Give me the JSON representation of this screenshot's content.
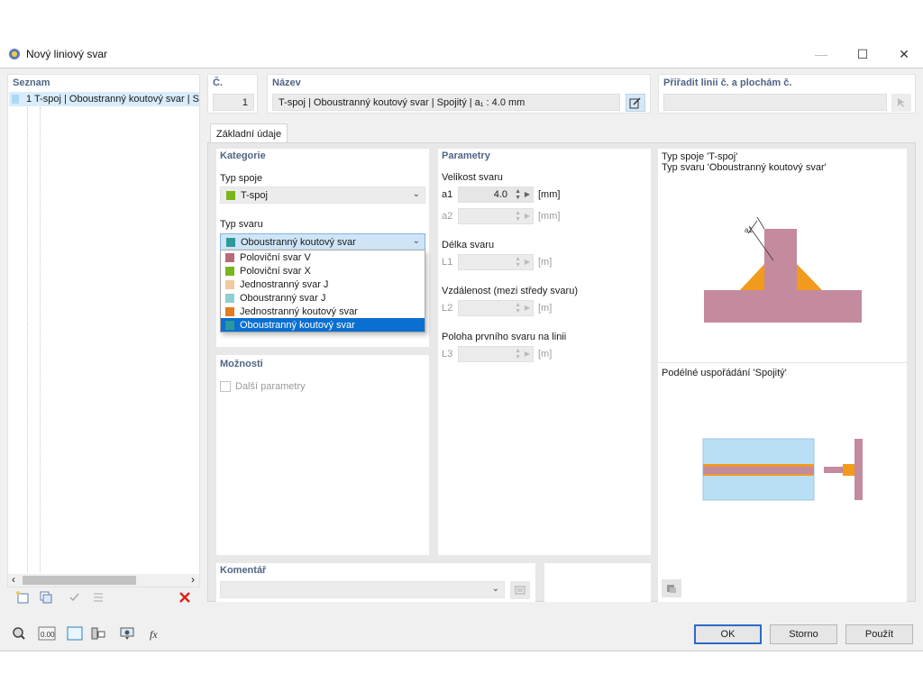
{
  "window": {
    "title": "Nový liniový svar",
    "minimize": "—",
    "maximize": "☐",
    "close": "✕"
  },
  "list": {
    "title": "Seznam",
    "items": [
      {
        "label": "1  T-spoj | Oboustranný koutový svar | S",
        "color": "#a9d9f5"
      }
    ],
    "scroll_left": "‹",
    "scroll_right": "›"
  },
  "header": {
    "no_label": "Č.",
    "no_value": "1",
    "name_label": "Název",
    "name_value": "T-spoj | Oboustranný koutový svar | Spojitý | a₁ : 4.0 mm",
    "assign_label": "Přiřadit linii č. a plochám č.",
    "assign_value": ""
  },
  "tabs": [
    {
      "label": "Základní údaje"
    }
  ],
  "category": {
    "title": "Kategorie",
    "joint_type_label": "Typ spoje",
    "joint_type_value": "T-spoj",
    "joint_type_color": "#7ab51d",
    "weld_type_label": "Typ svaru",
    "weld_type_value": "Oboustranný koutový svar",
    "weld_type_color": "#2a9a9a",
    "options": [
      {
        "label": "Poloviční svar V",
        "color": "#b86a7a"
      },
      {
        "label": "Poloviční svar X",
        "color": "#7ab51d"
      },
      {
        "label": "Jednostranný svar J",
        "color": "#f2c9a0"
      },
      {
        "label": "Oboustranný svar J",
        "color": "#8ecfd0"
      },
      {
        "label": "Jednostranný koutový svar",
        "color": "#e57c1e"
      },
      {
        "label": "Oboustranný koutový svar",
        "color": "#2a9a9a"
      }
    ]
  },
  "options_section": {
    "title": "Možnosti",
    "more_params": "Další parametry"
  },
  "parameters": {
    "title": "Parametry",
    "weld_size_label": "Velikost svaru",
    "a1_label": "a1",
    "a1_value": "4.0",
    "a1_unit": "[mm]",
    "a2_label": "a2",
    "a2_value": "",
    "a2_unit": "[mm]",
    "weld_length_label": "Délka svaru",
    "l1_label": "L1",
    "l1_unit": "[m]",
    "spacing_label": "Vzdálenost (mezi středy svaru)",
    "l2_label": "L2",
    "l2_unit": "[m]",
    "first_pos_label": "Poloha prvního svaru na linii",
    "l3_label": "L3",
    "l3_unit": "[m]"
  },
  "preview": {
    "joint_caption": "Typ spoje 'T-spoj'",
    "weld_caption": "Typ svaru 'Oboustranný koutový svar'",
    "a1_mark": "a1",
    "longitudinal_caption": "Podélné uspořádání 'Spojitý'"
  },
  "comment": {
    "title": "Komentář",
    "value": ""
  },
  "buttons": {
    "ok": "OK",
    "cancel": "Storno",
    "apply": "Použít"
  },
  "colors": {
    "section_title": "#4f6585",
    "accent": "#0a6fd0",
    "steel": "#c48a9e",
    "weld": "#f29a1c",
    "plate_blue": "#b9dff5"
  }
}
